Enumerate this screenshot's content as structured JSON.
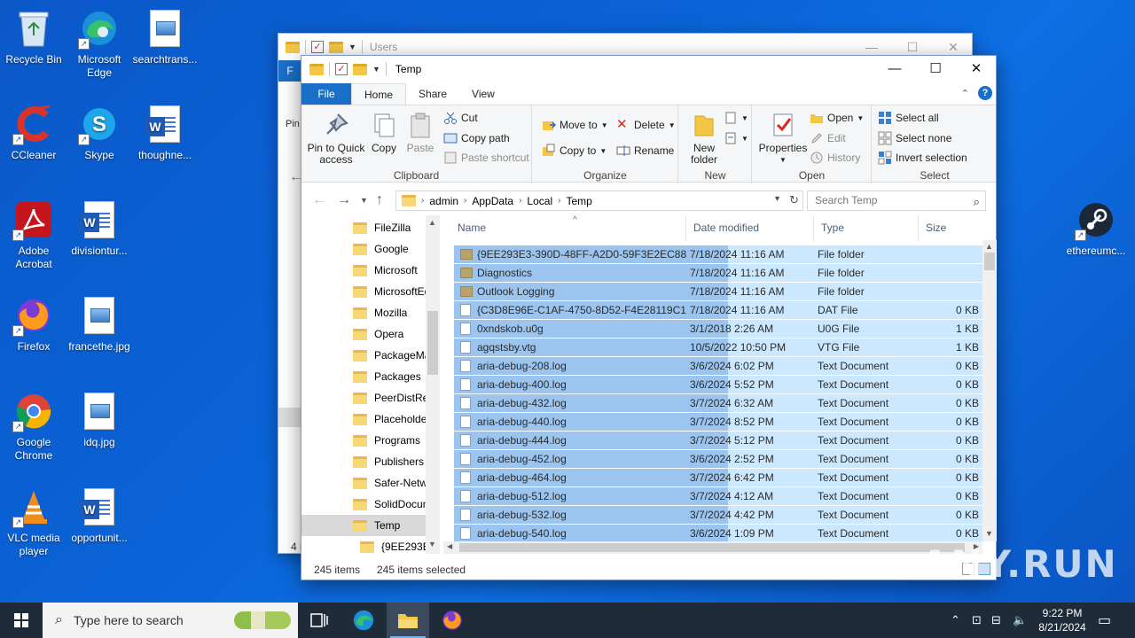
{
  "desktop": {
    "icons": [
      {
        "label": "Recycle Bin",
        "icon": "recycle-bin-icon"
      },
      {
        "label": "Microsoft Edge",
        "icon": "edge-icon"
      },
      {
        "label": "searchtrans...",
        "icon": "image-file-icon"
      },
      {
        "label": "CCleaner",
        "icon": "ccleaner-icon"
      },
      {
        "label": "Skype",
        "icon": "skype-icon"
      },
      {
        "label": "thoughne...",
        "icon": "word-doc-icon"
      },
      {
        "label": "Adobe Acrobat",
        "icon": "acrobat-icon"
      },
      {
        "label": "divisiontur...",
        "icon": "word-doc-icon"
      },
      {
        "label": "Firefox",
        "icon": "firefox-icon"
      },
      {
        "label": "francethe.jpg",
        "icon": "image-file-icon"
      },
      {
        "label": "Google Chrome",
        "icon": "chrome-icon"
      },
      {
        "label": "idq.jpg",
        "icon": "image-file-icon"
      },
      {
        "label": "VLC media player",
        "icon": "vlc-icon"
      },
      {
        "label": "opportunit...",
        "icon": "word-doc-icon"
      },
      {
        "label": "ethereumc...",
        "icon": "steam-icon"
      }
    ]
  },
  "back_window": {
    "title": "Users",
    "file_tab": "F",
    "pin_label": "Pin",
    "item_count": "4 i"
  },
  "window": {
    "title": "Temp",
    "tabs": {
      "file": "File",
      "home": "Home",
      "share": "Share",
      "view": "View"
    },
    "ribbon": {
      "clipboard": {
        "pin": "Pin to Quick access",
        "copy": "Copy",
        "paste": "Paste",
        "cut": "Cut",
        "copy_path": "Copy path",
        "paste_shortcut": "Paste shortcut",
        "label": "Clipboard"
      },
      "organize": {
        "move_to": "Move to",
        "copy_to": "Copy to",
        "delete": "Delete",
        "rename": "Rename",
        "label": "Organize"
      },
      "new": {
        "new_folder": "New folder",
        "label": "New"
      },
      "open": {
        "properties": "Properties",
        "open": "Open",
        "edit": "Edit",
        "history": "History",
        "label": "Open"
      },
      "select": {
        "select_all": "Select all",
        "select_none": "Select none",
        "invert": "Invert selection",
        "label": "Select"
      }
    },
    "address": {
      "crumbs": [
        "admin",
        "AppData",
        "Local",
        "Temp"
      ]
    },
    "search_placeholder": "Search Temp",
    "nav_items": [
      "FileZilla",
      "Google",
      "Microsoft",
      "MicrosoftEd",
      "Mozilla",
      "Opera",
      "PackageMa",
      "Packages",
      "PeerDistRep",
      "Placeholder",
      "Programs",
      "Publishers",
      "Safer-Netwo",
      "SolidDocum",
      "Temp",
      "{9EE293E3-"
    ],
    "nav_selected": "Temp",
    "columns": {
      "name": "Name",
      "date": "Date modified",
      "type": "Type",
      "size": "Size"
    },
    "files": [
      {
        "name": "{9EE293E3-390D-48FF-A2D0-59F3E2EC88...",
        "date": "7/18/2024 11:16 AM",
        "type": "File folder",
        "size": "",
        "kind": "folder"
      },
      {
        "name": "Diagnostics",
        "date": "7/18/2024 11:16 AM",
        "type": "File folder",
        "size": "",
        "kind": "folder"
      },
      {
        "name": "Outlook Logging",
        "date": "7/18/2024 11:16 AM",
        "type": "File folder",
        "size": "",
        "kind": "folder"
      },
      {
        "name": "{C3D8E96E-C1AF-4750-8D52-F4E28119C1...",
        "date": "7/18/2024 11:16 AM",
        "type": "DAT File",
        "size": "0 KB",
        "kind": "file"
      },
      {
        "name": "0xndskob.u0g",
        "date": "3/1/2018 2:26 AM",
        "type": "U0G File",
        "size": "1 KB",
        "kind": "file"
      },
      {
        "name": "agqstsby.vtg",
        "date": "10/5/2022 10:50 PM",
        "type": "VTG File",
        "size": "1 KB",
        "kind": "file"
      },
      {
        "name": "aria-debug-208.log",
        "date": "3/6/2024 6:02 PM",
        "type": "Text Document",
        "size": "0 KB",
        "kind": "file"
      },
      {
        "name": "aria-debug-400.log",
        "date": "3/6/2024 5:52 PM",
        "type": "Text Document",
        "size": "0 KB",
        "kind": "file"
      },
      {
        "name": "aria-debug-432.log",
        "date": "3/7/2024 6:32 AM",
        "type": "Text Document",
        "size": "0 KB",
        "kind": "file"
      },
      {
        "name": "aria-debug-440.log",
        "date": "3/7/2024 8:52 PM",
        "type": "Text Document",
        "size": "0 KB",
        "kind": "file"
      },
      {
        "name": "aria-debug-444.log",
        "date": "3/7/2024 5:12 PM",
        "type": "Text Document",
        "size": "0 KB",
        "kind": "file"
      },
      {
        "name": "aria-debug-452.log",
        "date": "3/6/2024 2:52 PM",
        "type": "Text Document",
        "size": "0 KB",
        "kind": "file"
      },
      {
        "name": "aria-debug-464.log",
        "date": "3/7/2024 6:42 PM",
        "type": "Text Document",
        "size": "0 KB",
        "kind": "file"
      },
      {
        "name": "aria-debug-512.log",
        "date": "3/7/2024 4:12 AM",
        "type": "Text Document",
        "size": "0 KB",
        "kind": "file"
      },
      {
        "name": "aria-debug-532.log",
        "date": "3/7/2024 4:42 PM",
        "type": "Text Document",
        "size": "0 KB",
        "kind": "file"
      },
      {
        "name": "aria-debug-540.log",
        "date": "3/6/2024 1:09 PM",
        "type": "Text Document",
        "size": "0 KB",
        "kind": "file"
      }
    ],
    "status": {
      "items": "245 items",
      "selected": "245 items selected"
    }
  },
  "watermark": "ANY.RUN",
  "taskbar": {
    "search_placeholder": "Type here to search",
    "time": "9:22 PM",
    "date": "8/21/2024"
  },
  "colors": {
    "accent": "#1a6fc9",
    "selection": "#cce8ff",
    "drag_selection": "#9bc4ef",
    "taskbar": "#1f2b38"
  }
}
